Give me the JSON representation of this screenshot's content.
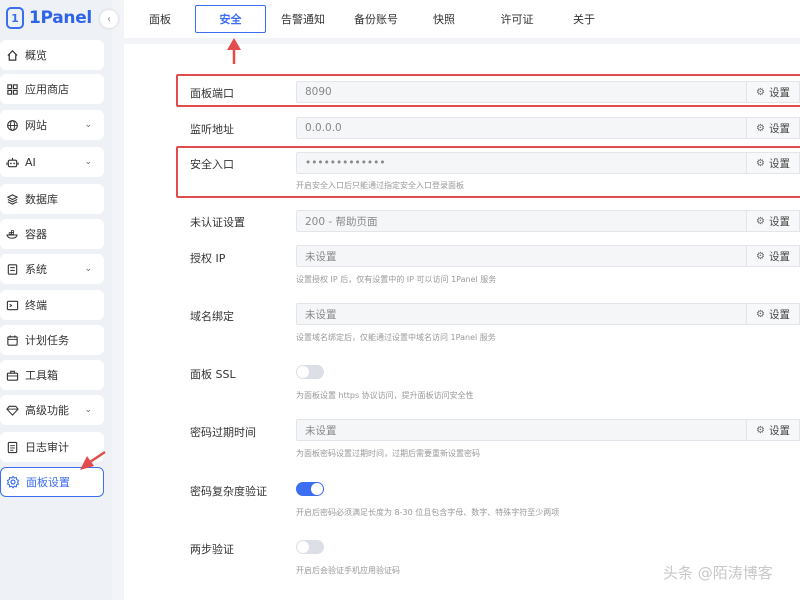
{
  "app": {
    "logo_text": "1Panel",
    "logo_glyph": "1",
    "collapse_glyph": "‹"
  },
  "sidebar": {
    "items": [
      {
        "label": "概览",
        "icon": "home-icon"
      },
      {
        "label": "应用商店",
        "icon": "grid-icon"
      },
      {
        "label": "网站",
        "icon": "globe-icon",
        "chevron": "⌄"
      },
      {
        "label": "AI",
        "icon": "robot-icon",
        "chevron": "⌄"
      },
      {
        "label": "数据库",
        "icon": "database-icon"
      },
      {
        "label": "容器",
        "icon": "container-icon"
      },
      {
        "label": "系统",
        "icon": "system-icon",
        "chevron": "⌄"
      },
      {
        "label": "终端",
        "icon": "terminal-icon"
      },
      {
        "label": "计划任务",
        "icon": "calendar-icon"
      },
      {
        "label": "工具箱",
        "icon": "toolbox-icon"
      },
      {
        "label": "高级功能",
        "icon": "diamond-icon",
        "chevron": "⌄"
      },
      {
        "label": "日志审计",
        "icon": "log-icon"
      },
      {
        "label": "面板设置",
        "icon": "gear-icon"
      }
    ]
  },
  "tabs": [
    "面板",
    "安全",
    "告警通知",
    "备份账号",
    "快照",
    "许可证",
    "关于"
  ],
  "settings": {
    "button_label": "设置",
    "port": {
      "label": "面板端口",
      "value": "8090"
    },
    "listen": {
      "label": "监听地址",
      "value": "0.0.0.0"
    },
    "entrance": {
      "label": "安全入口",
      "value": "•••••••••••••",
      "hint": "开启安全入口后只能通过指定安全入口登录面板"
    },
    "unauth": {
      "label": "未认证设置",
      "value": "200 - 帮助页面"
    },
    "auth_ip": {
      "label": "授权 IP",
      "value": "未设置",
      "hint": "设置授权 IP 后，仅有设置中的 IP 可以访问 1Panel 服务"
    },
    "domain": {
      "label": "域名绑定",
      "value": "未设置",
      "hint": "设置域名绑定后，仅能通过设置中域名访问 1Panel 服务"
    },
    "ssl": {
      "label": "面板 SSL",
      "hint": "为面板设置 https 协议访问，提升面板访问安全性",
      "enabled": false
    },
    "expire": {
      "label": "密码过期时间",
      "value": "未设置",
      "hint": "为面板密码设置过期时间，过期后需要重新设置密码"
    },
    "complexity": {
      "label": "密码复杂度验证",
      "hint": "开启后密码必须满足长度为 8-30 位且包含字母、数字、特殊字符至少两项",
      "enabled": true
    },
    "mfa": {
      "label": "两步验证",
      "hint": "开启后会验证手机应用验证码",
      "enabled": false
    }
  },
  "watermark": "头条 @陌涛博客",
  "colors": {
    "accent": "#3b6ef0",
    "annotation": "#e24c4c"
  }
}
